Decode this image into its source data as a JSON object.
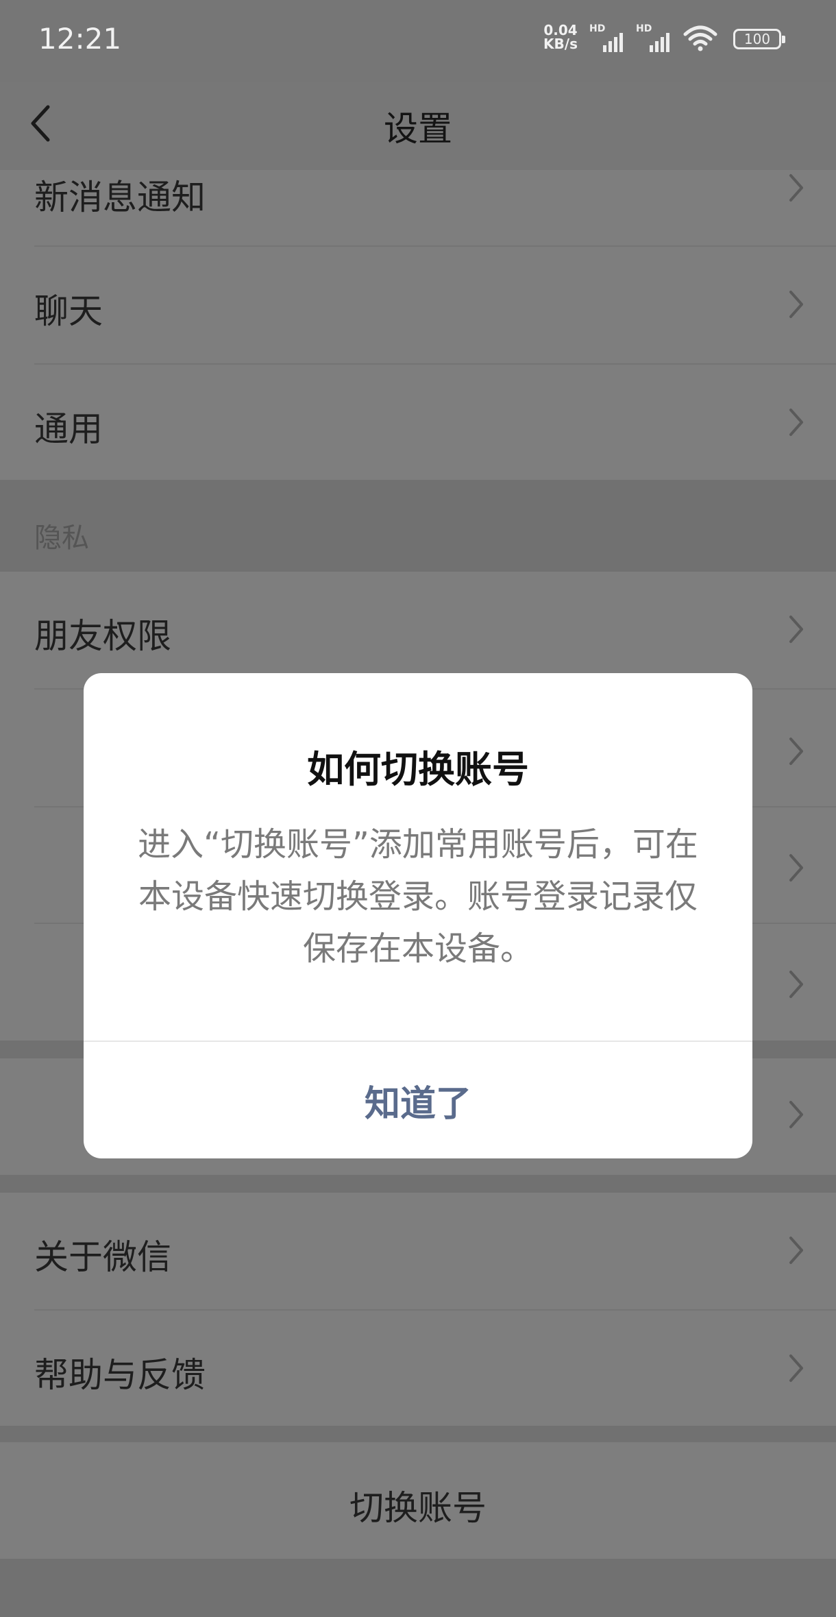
{
  "status_bar": {
    "time": "12:21",
    "net_speed_value": "0.04",
    "net_speed_unit": "KB/s",
    "hd_label_1": "HD",
    "hd_label_2": "HD",
    "battery": "100"
  },
  "nav": {
    "title": "设置"
  },
  "rows": {
    "new_message_notification": "新消息通知",
    "chat": "聊天",
    "general": "通用",
    "privacy_section": "隐私",
    "friend_permissions": "朋友权限",
    "about_wechat": "关于微信",
    "help_feedback": "帮助与反馈"
  },
  "switch_account": "切换账号",
  "dialog": {
    "title": "如何切换账号",
    "body": "进入“切换账号”添加常用账号后，可在本设备快速切换登录。账号登录记录仅保存在本设备。",
    "button": "知道了"
  }
}
